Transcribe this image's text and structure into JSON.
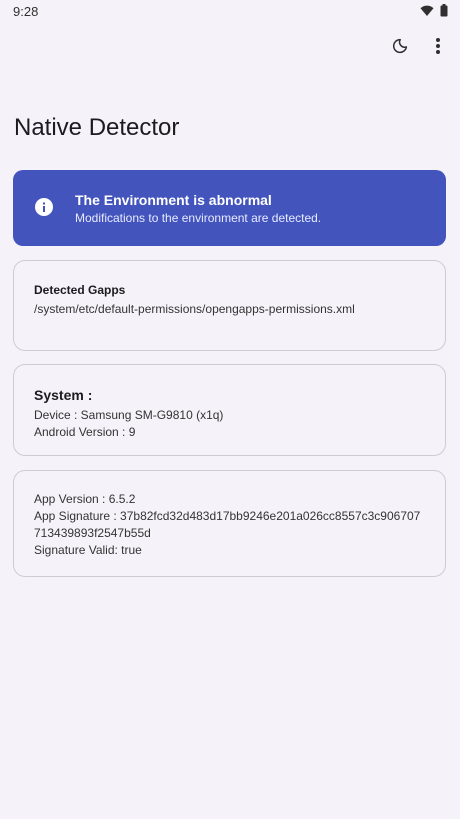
{
  "status_bar": {
    "time": "9:28"
  },
  "toolbar": {
    "theme_icon": "moon-icon",
    "menu_icon": "more-vert-icon"
  },
  "page": {
    "title": "Native Detector"
  },
  "banner": {
    "icon": "info-icon",
    "title": "The Environment is abnormal",
    "subtitle": "Modifications to the environment are detected.",
    "color": "#4355bd"
  },
  "detected_card": {
    "title": "Detected Gapps",
    "path": "/system/etc/default-permissions/opengapps-permissions.xml"
  },
  "system_card": {
    "title": "System :",
    "device": "Device : Samsung SM-G9810  (x1q)",
    "android_version": "Android Version : 9"
  },
  "app_card": {
    "app_version": "App Version : 6.5.2",
    "app_signature": "App Signature : 37b82fcd32d483d17bb9246e201a026cc8557c3c906707713439893f2547b55d",
    "signature_valid": "Signature Valid: true"
  }
}
